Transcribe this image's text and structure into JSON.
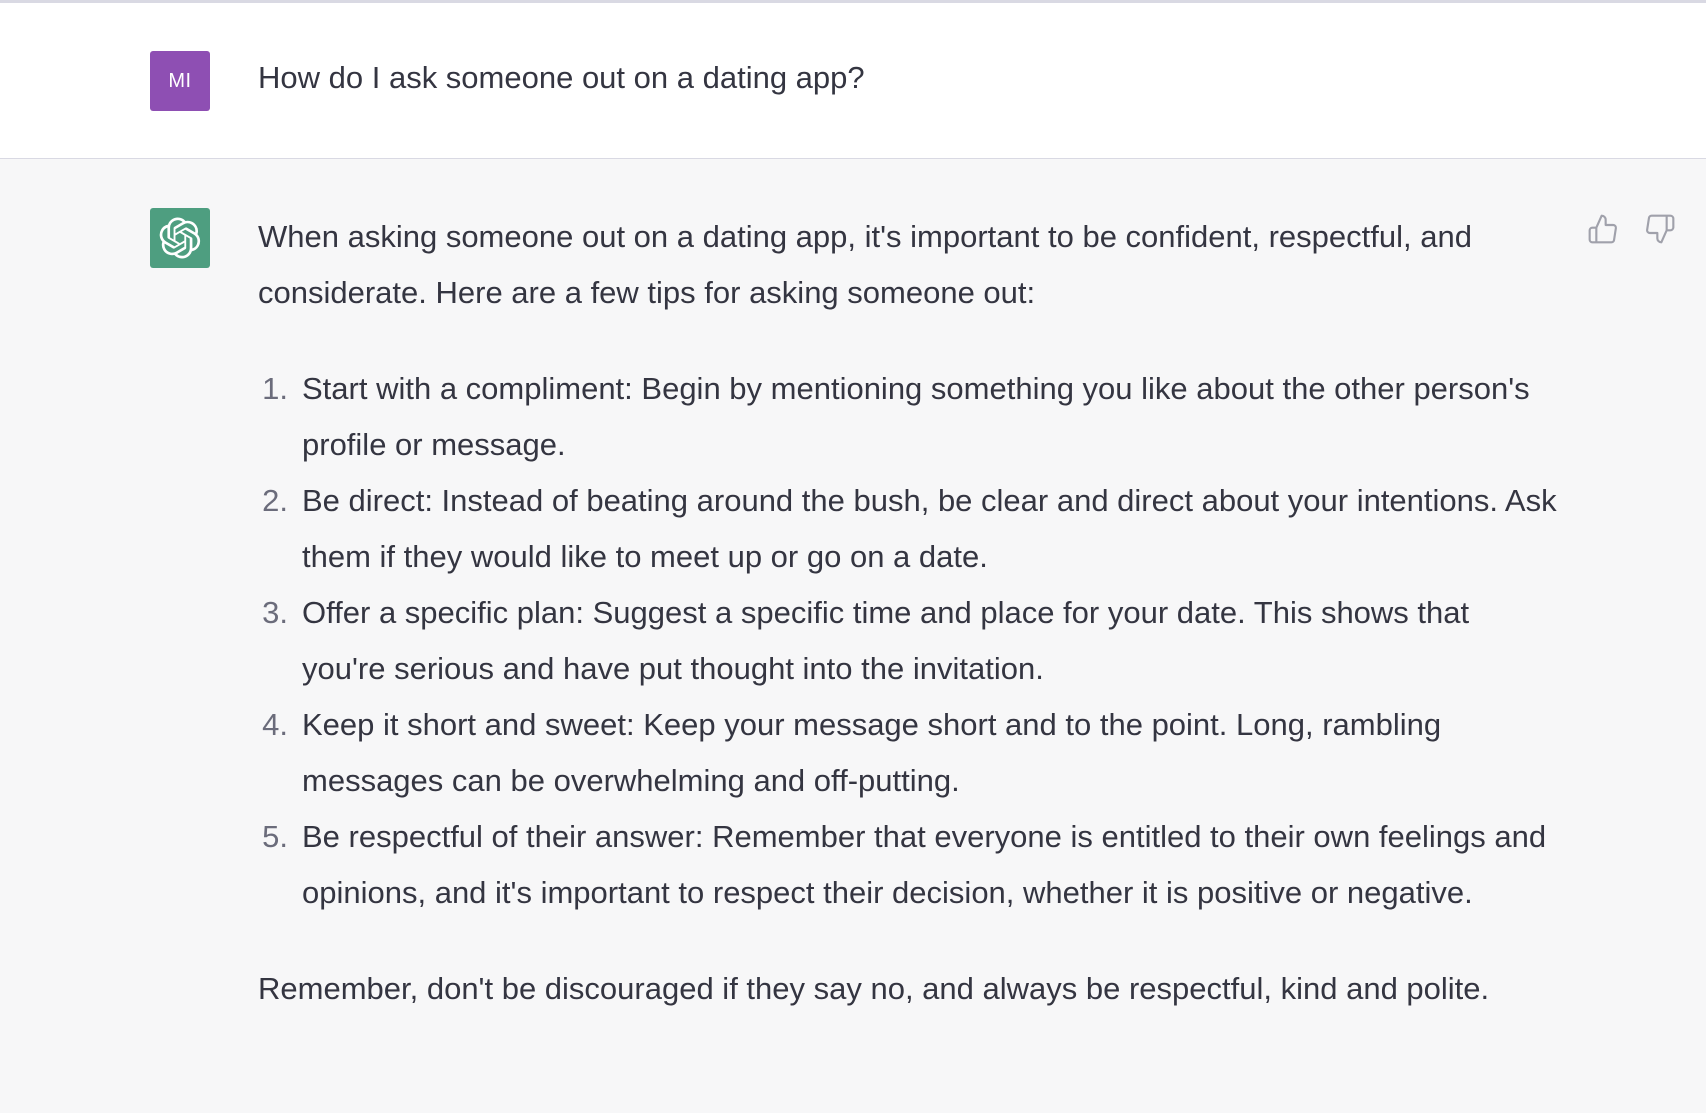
{
  "user_message": {
    "avatar_initials": "MI",
    "avatar_color": "#8e4fb3",
    "text": "How do I ask someone out on a dating app?"
  },
  "assistant_message": {
    "avatar_icon": "openai-logo-icon",
    "avatar_color": "#4e9e80",
    "intro": "When asking someone out on a dating app, it's important to be confident, respectful, and considerate. Here are a few tips for asking someone out:",
    "tips": [
      {
        "number": "1.",
        "text": "Start with a compliment: Begin by mentioning something you like about the other person's profile or message."
      },
      {
        "number": "2.",
        "text": "Be direct: Instead of beating around the bush, be clear and direct about your intentions. Ask them if they would like to meet up or go on a date."
      },
      {
        "number": "3.",
        "text": "Offer a specific plan: Suggest a specific time and place for your date. This shows that you're serious and have put thought into the invitation."
      },
      {
        "number": "4.",
        "text": "Keep it short and sweet: Keep your message short and to the point. Long, rambling messages can be overwhelming and off-putting."
      },
      {
        "number": "5.",
        "text": "Be respectful of their answer: Remember that everyone is entitled to their own feelings and opinions, and it's important to respect their decision, whether it is positive or negative."
      }
    ],
    "closing": "Remember, don't be discouraged if they say no, and always be respectful, kind and polite."
  },
  "feedback": {
    "thumbs_up_icon": "thumbs-up-icon",
    "thumbs_down_icon": "thumbs-down-icon"
  }
}
